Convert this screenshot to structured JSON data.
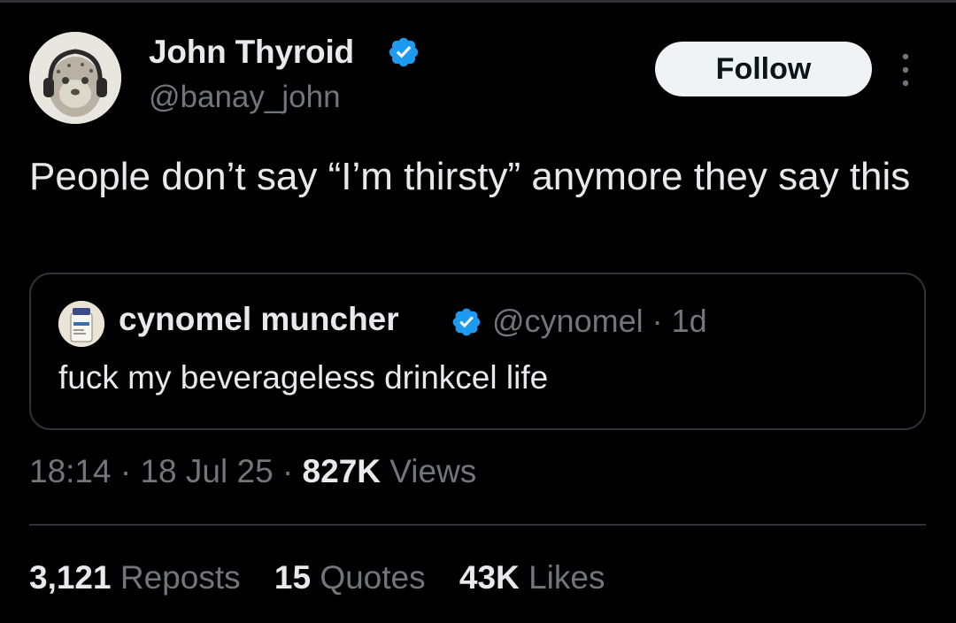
{
  "author": {
    "name": "John Thyroid",
    "handle": "@banay_john",
    "verified": true
  },
  "follow_label": "Follow",
  "tweet_text": "People don’t say “I’m thirsty” anymore they say this",
  "quoted": {
    "name": "cynomel muncher",
    "handle": "@cynomel",
    "separator": "·",
    "age": "1d",
    "text": "fuck my beverageless drinkcel life"
  },
  "meta": {
    "time": "18:14",
    "date": "18 Jul 25",
    "views_count": "827K",
    "views_label": "Views",
    "separator": "·"
  },
  "stats": {
    "reposts_count": "3,121",
    "reposts_label": "Reposts",
    "quotes_count": "15",
    "quotes_label": "Quotes",
    "likes_count": "43K",
    "likes_label": "Likes"
  },
  "colors": {
    "background": "#000000",
    "text": "#e7e9ea",
    "secondary": "#71767b",
    "verified": "#1d9bf0",
    "border": "#2f3336"
  }
}
